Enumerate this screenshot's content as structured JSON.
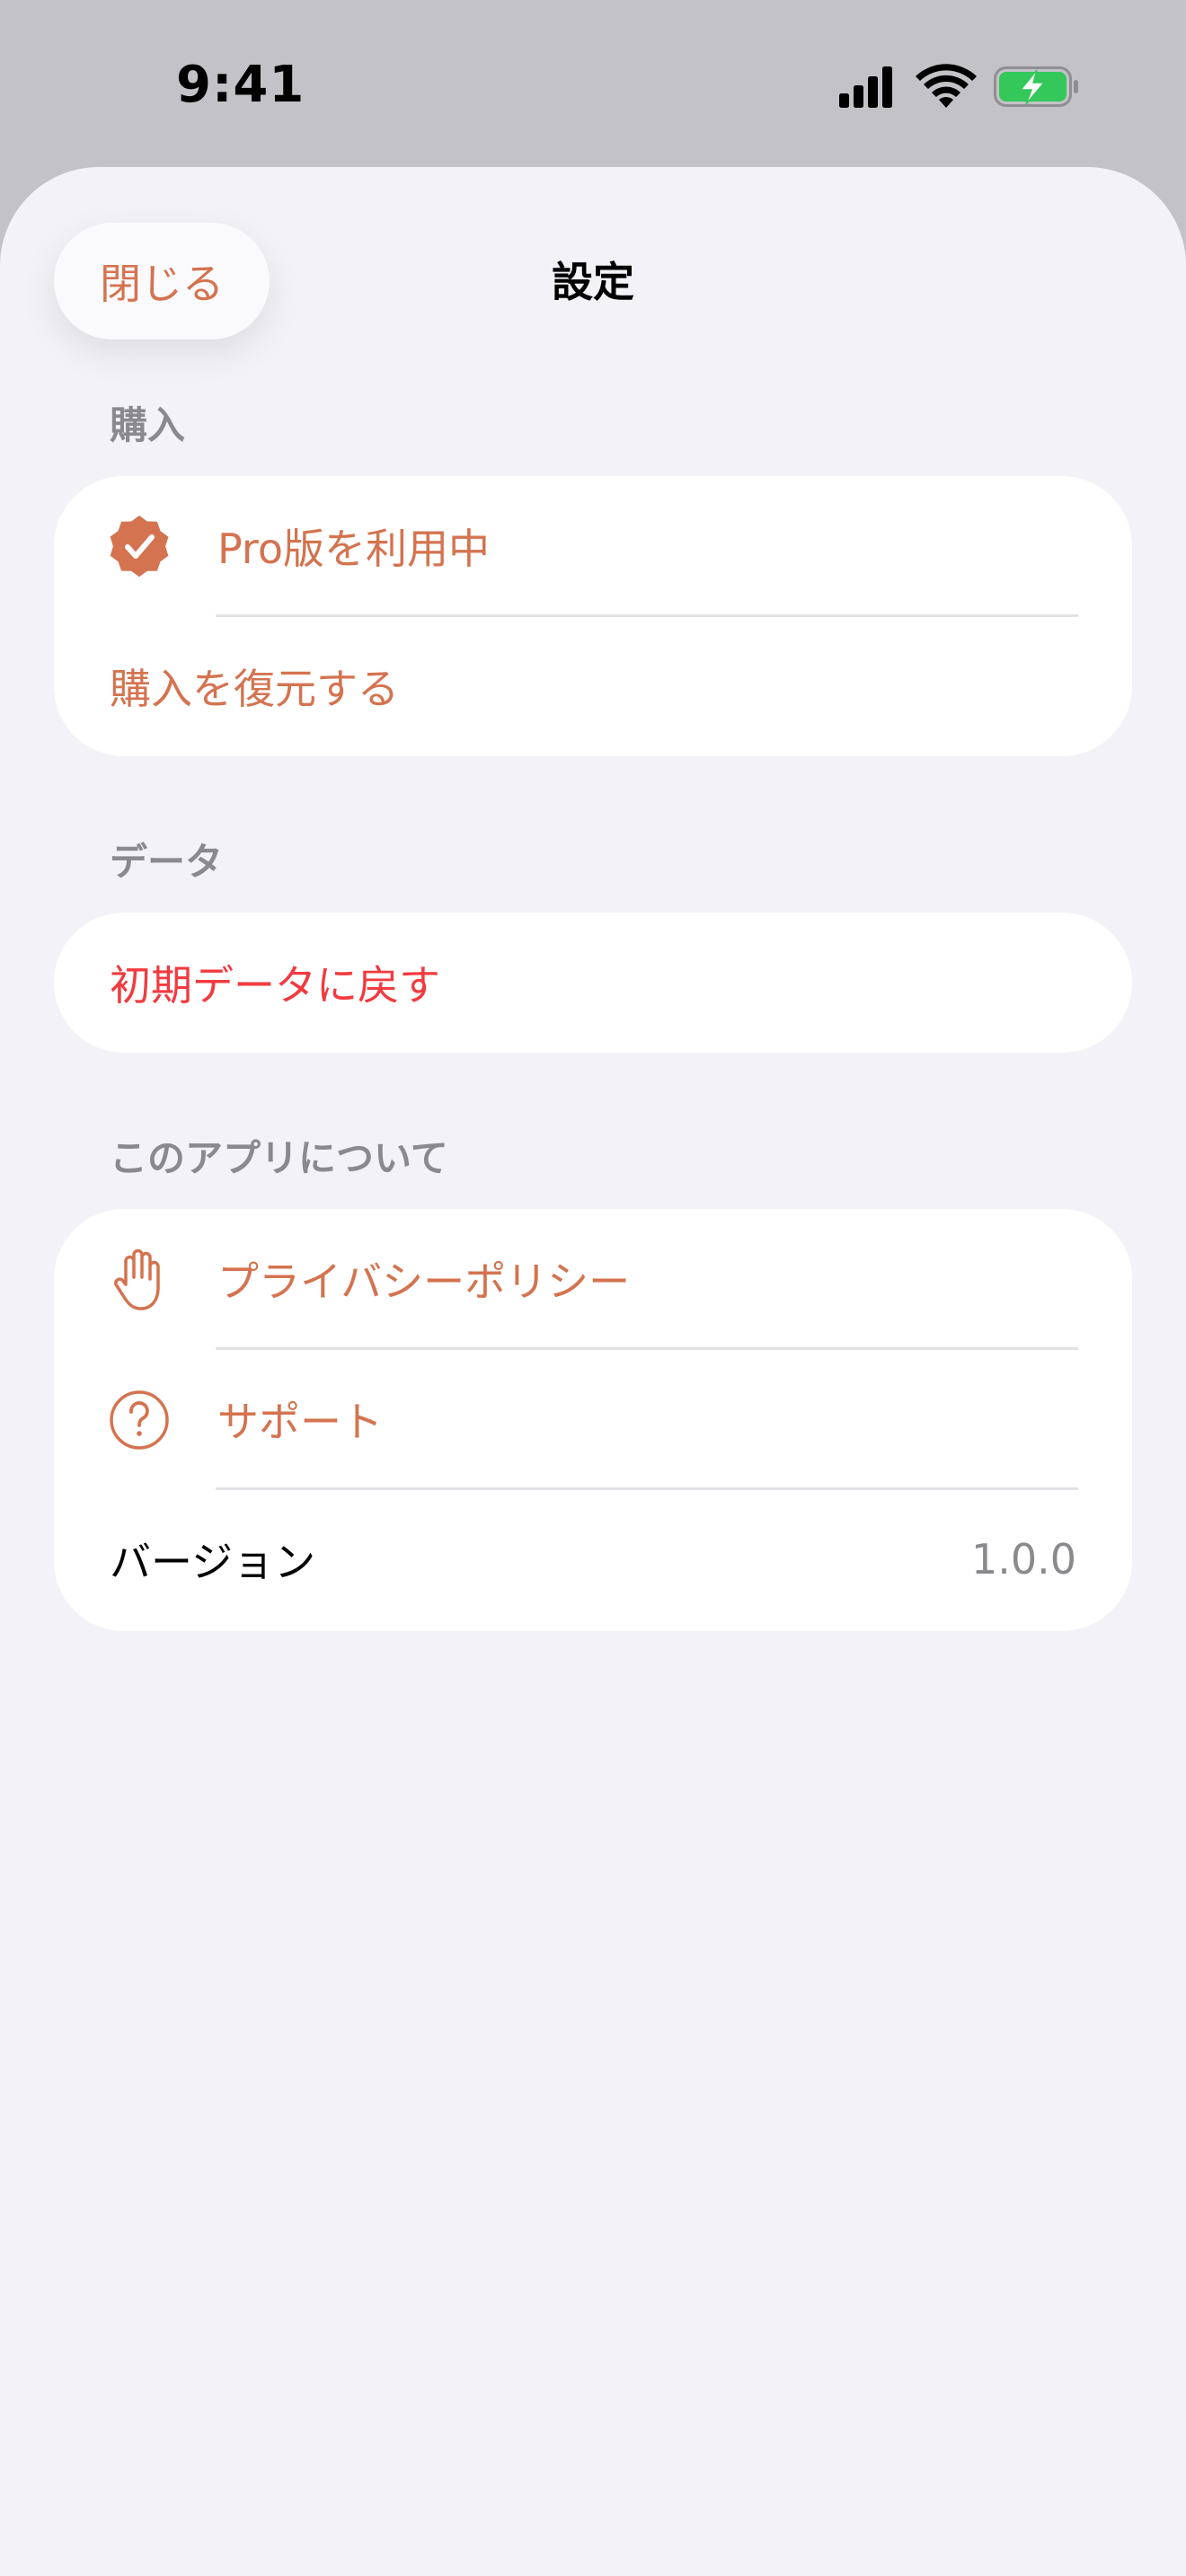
{
  "status_bar": {
    "time": "9:41",
    "icons": [
      "cellular-signal-icon",
      "wifi-icon",
      "battery-charging-icon"
    ],
    "battery_color": "#34c759"
  },
  "nav": {
    "close_label": "閉じる",
    "title": "設定"
  },
  "colors": {
    "accent": "#d4734f",
    "destructive": "#f23a3f",
    "secondary_text": "#8a8a8e",
    "background": "#f2f2f7"
  },
  "sections": {
    "purchase": {
      "header": "購入",
      "pro_status": {
        "label": "Pro版を利用中",
        "icon": "checkmark-seal-icon"
      },
      "restore": {
        "label": "購入を復元する"
      }
    },
    "data": {
      "header": "データ",
      "reset": {
        "label": "初期データに戻す"
      }
    },
    "about": {
      "header": "このアプリについて",
      "privacy": {
        "label": "プライバシーポリシー",
        "icon": "hand-raised-icon"
      },
      "support": {
        "label": "サポート",
        "icon": "questionmark-circle-icon"
      },
      "version": {
        "label": "バージョン",
        "value": "1.0.0"
      }
    }
  }
}
